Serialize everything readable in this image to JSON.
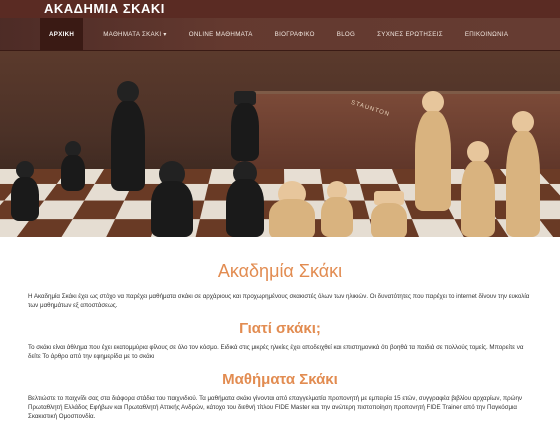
{
  "brand": {
    "title": "ΑΚΑΔΗΜΙΑ ΣΚΑΚΙ"
  },
  "nav": {
    "items": [
      {
        "label": "ΑΡΧΙΚΗ"
      },
      {
        "label": "ΜΑΘΗΜΑΤΑ ΣΚΑΚΙ"
      },
      {
        "label": "ONLINE ΜΑΘΗΜΑΤΑ"
      },
      {
        "label": "ΒΙΟΓΡΑΦΙΚΟ"
      },
      {
        "label": "BLOG"
      },
      {
        "label": "ΣΥΧΝΕΣ ΕΡΩΤΗΣΕΙΣ"
      },
      {
        "label": "ΕΠΙΚΟΙΝΩΝΙΑ"
      }
    ]
  },
  "hero": {
    "box_label": "STAUNTON"
  },
  "sections": {
    "main_title": "Ακαδημία Σκάκι",
    "main_text": "Η Ακαδημία Σκάκι έχει ως στόχο να παρέχει μαθήματα σκάκι σε αρχάριους και προχωρημένους σκακιστές όλων των ηλικιών. Οι δυνατότητες που παρέχει το internet δίνουν την ευκολία των μαθημάτων εξ αποστάσεως.",
    "why_title": "Γιατί σκάκι;",
    "why_text": "Το σκάκι είναι άθλημα που έχει εκατομμύρια φίλους σε όλο τον κόσμο. Ειδικά στις μικρές ηλικίες έχει αποδειχθεί και επιστημονικά ότι βοηθά τα παιδιά σε πολλούς τομείς. Μπορείτε να δείτε Το άρθρο από την εφημερίδα με το σκάκι",
    "lessons_title": "Μαθήματα Σκάκι",
    "lessons_text": "Βελτιώστε το παιχνίδι σας στα διάφορα στάδια του παιχνιδιού. Τα μαθήματα σκάκι γίνονται από επαγγελματία προπονητή με εμπειρία 15 ετών, συγγραφέα βιβλίου αρχαρίων, πρώην Πρωταθλητή Ελλάδος Εφήβων και Πρωταθλητή Αττικής Ανδρών, κάτοχο του διεθνή τίτλου FIDE Master και την ανώτερη πιστοποίηση προπονητή FIDE Trainer από την Παγκόσμια Σκακιστική Ομοσπονδία."
  }
}
